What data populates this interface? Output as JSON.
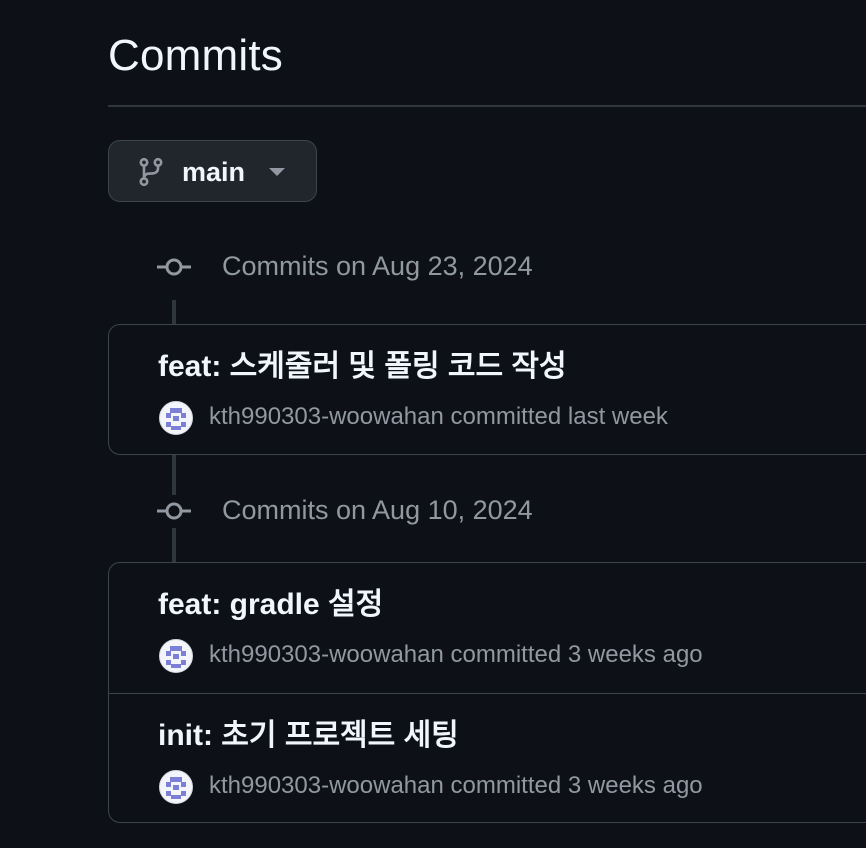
{
  "page": {
    "title": "Commits"
  },
  "branch": {
    "name": "main",
    "icon": "git-branch-icon",
    "dropdown_icon": "caret-down-icon"
  },
  "groups": [
    {
      "heading": "Commits on Aug 23, 2024",
      "commits": [
        {
          "message": "feat: 스케줄러 및 폴링 코드 작성",
          "author": "kth990303-woowahan",
          "action": "committed",
          "time": "last week"
        }
      ]
    },
    {
      "heading": "Commits on Aug 10, 2024",
      "commits": [
        {
          "message": "feat: gradle 설정",
          "author": "kth990303-woowahan",
          "action": "committed",
          "time": "3 weeks ago"
        },
        {
          "message": "init: 초기 프로젝트 세팅",
          "author": "kth990303-woowahan",
          "action": "committed",
          "time": "3 weeks ago"
        }
      ]
    }
  ],
  "colors": {
    "background": "#0d1117",
    "border": "#3d444d",
    "text_primary": "#f0f6fc",
    "text_muted": "#9198a1",
    "avatar_pixel": "#7c7fd6"
  }
}
